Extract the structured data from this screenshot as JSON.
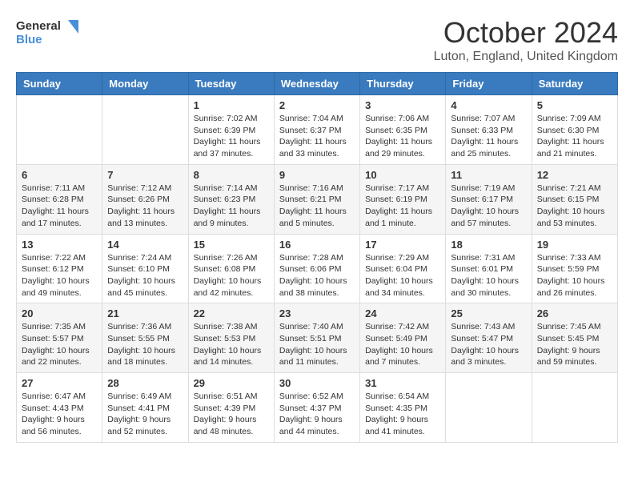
{
  "logo": {
    "general": "General",
    "blue": "Blue"
  },
  "title": "October 2024",
  "location": "Luton, England, United Kingdom",
  "days_of_week": [
    "Sunday",
    "Monday",
    "Tuesday",
    "Wednesday",
    "Thursday",
    "Friday",
    "Saturday"
  ],
  "weeks": [
    [
      {
        "day": "",
        "info": ""
      },
      {
        "day": "",
        "info": ""
      },
      {
        "day": "1",
        "info": "Sunrise: 7:02 AM\nSunset: 6:39 PM\nDaylight: 11 hours and 37 minutes."
      },
      {
        "day": "2",
        "info": "Sunrise: 7:04 AM\nSunset: 6:37 PM\nDaylight: 11 hours and 33 minutes."
      },
      {
        "day": "3",
        "info": "Sunrise: 7:06 AM\nSunset: 6:35 PM\nDaylight: 11 hours and 29 minutes."
      },
      {
        "day": "4",
        "info": "Sunrise: 7:07 AM\nSunset: 6:33 PM\nDaylight: 11 hours and 25 minutes."
      },
      {
        "day": "5",
        "info": "Sunrise: 7:09 AM\nSunset: 6:30 PM\nDaylight: 11 hours and 21 minutes."
      }
    ],
    [
      {
        "day": "6",
        "info": "Sunrise: 7:11 AM\nSunset: 6:28 PM\nDaylight: 11 hours and 17 minutes."
      },
      {
        "day": "7",
        "info": "Sunrise: 7:12 AM\nSunset: 6:26 PM\nDaylight: 11 hours and 13 minutes."
      },
      {
        "day": "8",
        "info": "Sunrise: 7:14 AM\nSunset: 6:23 PM\nDaylight: 11 hours and 9 minutes."
      },
      {
        "day": "9",
        "info": "Sunrise: 7:16 AM\nSunset: 6:21 PM\nDaylight: 11 hours and 5 minutes."
      },
      {
        "day": "10",
        "info": "Sunrise: 7:17 AM\nSunset: 6:19 PM\nDaylight: 11 hours and 1 minute."
      },
      {
        "day": "11",
        "info": "Sunrise: 7:19 AM\nSunset: 6:17 PM\nDaylight: 10 hours and 57 minutes."
      },
      {
        "day": "12",
        "info": "Sunrise: 7:21 AM\nSunset: 6:15 PM\nDaylight: 10 hours and 53 minutes."
      }
    ],
    [
      {
        "day": "13",
        "info": "Sunrise: 7:22 AM\nSunset: 6:12 PM\nDaylight: 10 hours and 49 minutes."
      },
      {
        "day": "14",
        "info": "Sunrise: 7:24 AM\nSunset: 6:10 PM\nDaylight: 10 hours and 45 minutes."
      },
      {
        "day": "15",
        "info": "Sunrise: 7:26 AM\nSunset: 6:08 PM\nDaylight: 10 hours and 42 minutes."
      },
      {
        "day": "16",
        "info": "Sunrise: 7:28 AM\nSunset: 6:06 PM\nDaylight: 10 hours and 38 minutes."
      },
      {
        "day": "17",
        "info": "Sunrise: 7:29 AM\nSunset: 6:04 PM\nDaylight: 10 hours and 34 minutes."
      },
      {
        "day": "18",
        "info": "Sunrise: 7:31 AM\nSunset: 6:01 PM\nDaylight: 10 hours and 30 minutes."
      },
      {
        "day": "19",
        "info": "Sunrise: 7:33 AM\nSunset: 5:59 PM\nDaylight: 10 hours and 26 minutes."
      }
    ],
    [
      {
        "day": "20",
        "info": "Sunrise: 7:35 AM\nSunset: 5:57 PM\nDaylight: 10 hours and 22 minutes."
      },
      {
        "day": "21",
        "info": "Sunrise: 7:36 AM\nSunset: 5:55 PM\nDaylight: 10 hours and 18 minutes."
      },
      {
        "day": "22",
        "info": "Sunrise: 7:38 AM\nSunset: 5:53 PM\nDaylight: 10 hours and 14 minutes."
      },
      {
        "day": "23",
        "info": "Sunrise: 7:40 AM\nSunset: 5:51 PM\nDaylight: 10 hours and 11 minutes."
      },
      {
        "day": "24",
        "info": "Sunrise: 7:42 AM\nSunset: 5:49 PM\nDaylight: 10 hours and 7 minutes."
      },
      {
        "day": "25",
        "info": "Sunrise: 7:43 AM\nSunset: 5:47 PM\nDaylight: 10 hours and 3 minutes."
      },
      {
        "day": "26",
        "info": "Sunrise: 7:45 AM\nSunset: 5:45 PM\nDaylight: 9 hours and 59 minutes."
      }
    ],
    [
      {
        "day": "27",
        "info": "Sunrise: 6:47 AM\nSunset: 4:43 PM\nDaylight: 9 hours and 56 minutes."
      },
      {
        "day": "28",
        "info": "Sunrise: 6:49 AM\nSunset: 4:41 PM\nDaylight: 9 hours and 52 minutes."
      },
      {
        "day": "29",
        "info": "Sunrise: 6:51 AM\nSunset: 4:39 PM\nDaylight: 9 hours and 48 minutes."
      },
      {
        "day": "30",
        "info": "Sunrise: 6:52 AM\nSunset: 4:37 PM\nDaylight: 9 hours and 44 minutes."
      },
      {
        "day": "31",
        "info": "Sunrise: 6:54 AM\nSunset: 4:35 PM\nDaylight: 9 hours and 41 minutes."
      },
      {
        "day": "",
        "info": ""
      },
      {
        "day": "",
        "info": ""
      }
    ]
  ]
}
